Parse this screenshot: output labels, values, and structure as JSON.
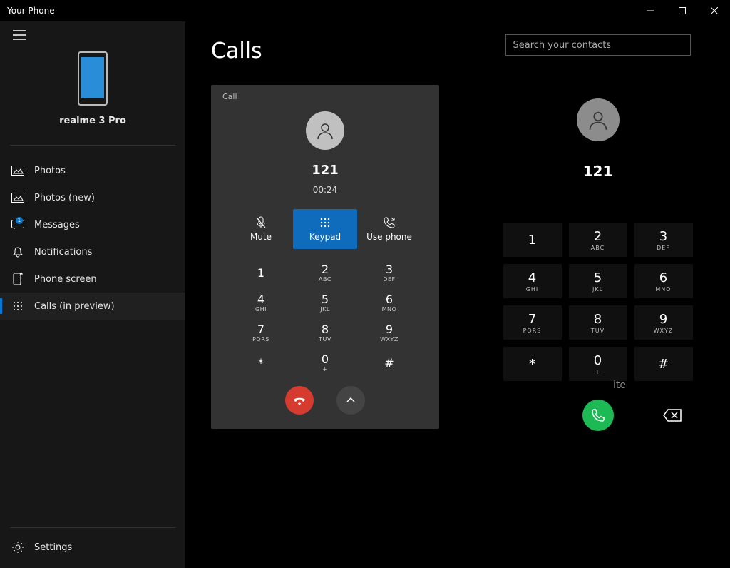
{
  "window": {
    "title": "Your Phone"
  },
  "sidebar": {
    "device_name": "realme 3 Pro",
    "items": [
      {
        "label": "Photos"
      },
      {
        "label": "Photos (new)"
      },
      {
        "label": "Messages",
        "badge": "1"
      },
      {
        "label": "Notifications"
      },
      {
        "label": "Phone screen"
      },
      {
        "label": "Calls (in preview)"
      }
    ],
    "settings_label": "Settings"
  },
  "calls": {
    "title": "Calls",
    "card_header": "Call",
    "number": "121",
    "duration": "00:24",
    "actions": {
      "mute": "Mute",
      "keypad": "Keypad",
      "use_phone": "Use phone"
    },
    "keys": [
      {
        "n": "1",
        "l": ""
      },
      {
        "n": "2",
        "l": "ABC"
      },
      {
        "n": "3",
        "l": "DEF"
      },
      {
        "n": "4",
        "l": "GHI"
      },
      {
        "n": "5",
        "l": "JKL"
      },
      {
        "n": "6",
        "l": "MNO"
      },
      {
        "n": "7",
        "l": "PQRS"
      },
      {
        "n": "8",
        "l": "TUV"
      },
      {
        "n": "9",
        "l": "WXYZ"
      },
      {
        "n": "*",
        "l": ""
      },
      {
        "n": "0",
        "l": "+"
      },
      {
        "n": "#",
        "l": ""
      }
    ],
    "dialpad_tip_fragment": "ite"
  },
  "dialer": {
    "search_placeholder": "Search your contacts",
    "number": "121",
    "keys": [
      {
        "n": "1",
        "l": ""
      },
      {
        "n": "2",
        "l": "ABC"
      },
      {
        "n": "3",
        "l": "DEF"
      },
      {
        "n": "4",
        "l": "GHI"
      },
      {
        "n": "5",
        "l": "JKL"
      },
      {
        "n": "6",
        "l": "MNO"
      },
      {
        "n": "7",
        "l": "PQRS"
      },
      {
        "n": "8",
        "l": "TUV"
      },
      {
        "n": "9",
        "l": "WXYZ"
      },
      {
        "n": "*",
        "l": ""
      },
      {
        "n": "0",
        "l": "+"
      },
      {
        "n": "#",
        "l": ""
      }
    ]
  }
}
